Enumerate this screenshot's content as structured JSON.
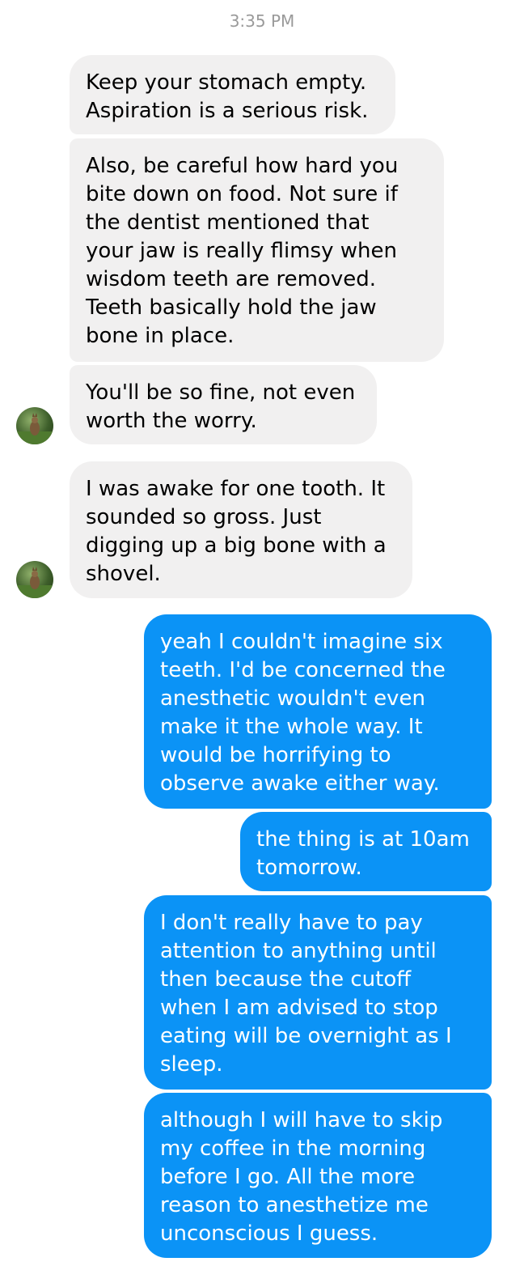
{
  "thread": {
    "timestamp": "3:35 PM",
    "messages": [
      {
        "sender": "them",
        "text": "Keep your stomach empty.\nAspiration is a serious risk."
      },
      {
        "sender": "them",
        "text": "Also, be careful how hard you\nbite down on food. Not sure if\nthe dentist mentioned that\nyour jaw is really flimsy when\nwisdom teeth are removed.\nTeeth basically hold the jaw\nbone in place."
      },
      {
        "sender": "them",
        "text": "You'll be so fine, not even\nworth the worry."
      },
      {
        "sender": "them",
        "text": "I was awake for one tooth. It\nsounded so gross. Just\ndigging up a big bone with a\nshovel."
      },
      {
        "sender": "me",
        "text": "yeah I couldn't imagine six\nteeth. I'd be concerned the\nanesthetic wouldn't even\nmake it the whole way. It\nwould be horrifying to\nobserve awake either way."
      },
      {
        "sender": "me",
        "text": "the thing is at 10am\ntomorrow."
      },
      {
        "sender": "me",
        "text": "I don't really have to pay\nattention to anything until\nthen because the cutoff\nwhen I am advised to stop\neating will be overnight as I\nsleep."
      },
      {
        "sender": "me",
        "text": "although I will have to skip\nmy coffee in the morning\nbefore I go. All the more\nreason to anesthetize me\nunconscious I guess."
      }
    ]
  },
  "colors": {
    "incoming_bubble": "#f1f0f0",
    "outgoing_bubble": "#0b93f6",
    "timestamp_text": "#9a9a9a"
  },
  "icons": {
    "avatar": "contact-photo-avatar"
  }
}
